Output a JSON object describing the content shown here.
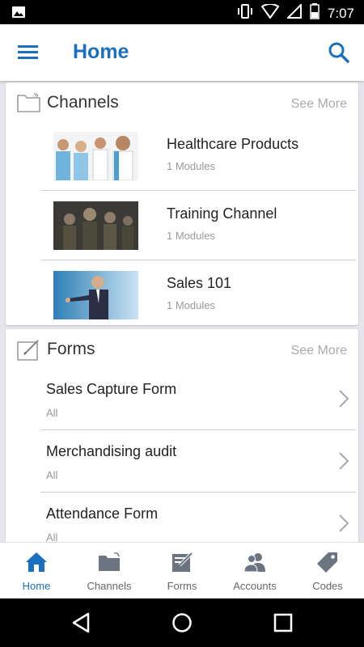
{
  "status_bar": {
    "time": "7:07"
  },
  "app_bar": {
    "title": "Home"
  },
  "channels": {
    "title": "Channels",
    "see_more": "See More",
    "items": [
      {
        "name": "Healthcare Products",
        "modules": "1 Modules"
      },
      {
        "name": "Training Channel",
        "modules": "1 Modules"
      },
      {
        "name": "Sales 101",
        "modules": "1 Modules"
      }
    ]
  },
  "forms": {
    "title": "Forms",
    "see_more": "See More",
    "items": [
      {
        "name": "Sales Capture Form",
        "sub": "All"
      },
      {
        "name": "Merchandising audit",
        "sub": "All"
      },
      {
        "name": "Attendance Form",
        "sub": "All"
      }
    ]
  },
  "bottom_nav": {
    "items": [
      {
        "label": "Home",
        "icon": "home-icon",
        "active": true
      },
      {
        "label": "Channels",
        "icon": "folder-icon"
      },
      {
        "label": "Forms",
        "icon": "form-edit-icon"
      },
      {
        "label": "Accounts",
        "icon": "people-icon"
      },
      {
        "label": "Codes",
        "icon": "tag-icon"
      }
    ]
  },
  "colors": {
    "accent": "#1a6fc0",
    "inactive": "#6b7480",
    "divider": "#cfcfcf",
    "background": "#e4e6eb"
  }
}
